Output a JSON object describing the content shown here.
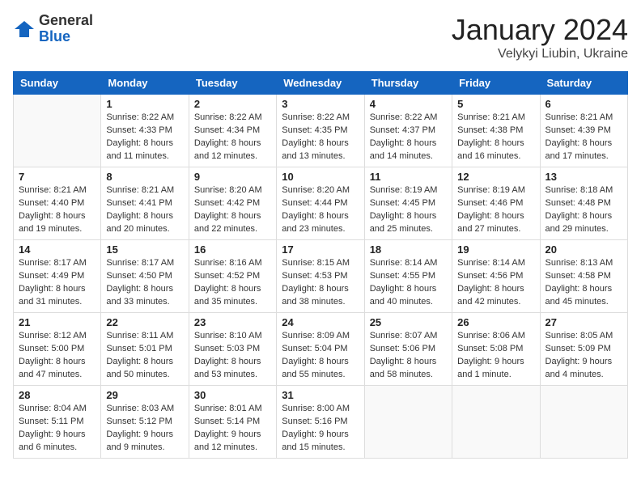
{
  "header": {
    "logo_general": "General",
    "logo_blue": "Blue",
    "month_title": "January 2024",
    "location": "Velykyi Liubin, Ukraine"
  },
  "weekdays": [
    "Sunday",
    "Monday",
    "Tuesday",
    "Wednesday",
    "Thursday",
    "Friday",
    "Saturday"
  ],
  "weeks": [
    [
      {
        "day": "",
        "info": ""
      },
      {
        "day": "1",
        "info": "Sunrise: 8:22 AM\nSunset: 4:33 PM\nDaylight: 8 hours\nand 11 minutes."
      },
      {
        "day": "2",
        "info": "Sunrise: 8:22 AM\nSunset: 4:34 PM\nDaylight: 8 hours\nand 12 minutes."
      },
      {
        "day": "3",
        "info": "Sunrise: 8:22 AM\nSunset: 4:35 PM\nDaylight: 8 hours\nand 13 minutes."
      },
      {
        "day": "4",
        "info": "Sunrise: 8:22 AM\nSunset: 4:37 PM\nDaylight: 8 hours\nand 14 minutes."
      },
      {
        "day": "5",
        "info": "Sunrise: 8:21 AM\nSunset: 4:38 PM\nDaylight: 8 hours\nand 16 minutes."
      },
      {
        "day": "6",
        "info": "Sunrise: 8:21 AM\nSunset: 4:39 PM\nDaylight: 8 hours\nand 17 minutes."
      }
    ],
    [
      {
        "day": "7",
        "info": ""
      },
      {
        "day": "8",
        "info": "Sunrise: 8:21 AM\nSunset: 4:41 PM\nDaylight: 8 hours\nand 20 minutes."
      },
      {
        "day": "9",
        "info": "Sunrise: 8:20 AM\nSunset: 4:42 PM\nDaylight: 8 hours\nand 22 minutes."
      },
      {
        "day": "10",
        "info": "Sunrise: 8:20 AM\nSunset: 4:44 PM\nDaylight: 8 hours\nand 23 minutes."
      },
      {
        "day": "11",
        "info": "Sunrise: 8:19 AM\nSunset: 4:45 PM\nDaylight: 8 hours\nand 25 minutes."
      },
      {
        "day": "12",
        "info": "Sunrise: 8:19 AM\nSunset: 4:46 PM\nDaylight: 8 hours\nand 27 minutes."
      },
      {
        "day": "13",
        "info": "Sunrise: 8:18 AM\nSunset: 4:48 PM\nDaylight: 8 hours\nand 29 minutes."
      }
    ],
    [
      {
        "day": "14",
        "info": ""
      },
      {
        "day": "15",
        "info": "Sunrise: 8:17 AM\nSunset: 4:50 PM\nDaylight: 8 hours\nand 33 minutes."
      },
      {
        "day": "16",
        "info": "Sunrise: 8:16 AM\nSunset: 4:52 PM\nDaylight: 8 hours\nand 35 minutes."
      },
      {
        "day": "17",
        "info": "Sunrise: 8:15 AM\nSunset: 4:53 PM\nDaylight: 8 hours\nand 38 minutes."
      },
      {
        "day": "18",
        "info": "Sunrise: 8:14 AM\nSunset: 4:55 PM\nDaylight: 8 hours\nand 40 minutes."
      },
      {
        "day": "19",
        "info": "Sunrise: 8:14 AM\nSunset: 4:56 PM\nDaylight: 8 hours\nand 42 minutes."
      },
      {
        "day": "20",
        "info": "Sunrise: 8:13 AM\nSunset: 4:58 PM\nDaylight: 8 hours\nand 45 minutes."
      }
    ],
    [
      {
        "day": "21",
        "info": ""
      },
      {
        "day": "22",
        "info": "Sunrise: 8:11 AM\nSunset: 5:01 PM\nDaylight: 8 hours\nand 50 minutes."
      },
      {
        "day": "23",
        "info": "Sunrise: 8:10 AM\nSunset: 5:03 PM\nDaylight: 8 hours\nand 53 minutes."
      },
      {
        "day": "24",
        "info": "Sunrise: 8:09 AM\nSunset: 5:04 PM\nDaylight: 8 hours\nand 55 minutes."
      },
      {
        "day": "25",
        "info": "Sunrise: 8:07 AM\nSunset: 5:06 PM\nDaylight: 8 hours\nand 58 minutes."
      },
      {
        "day": "26",
        "info": "Sunrise: 8:06 AM\nSunset: 5:08 PM\nDaylight: 9 hours\nand 1 minute."
      },
      {
        "day": "27",
        "info": "Sunrise: 8:05 AM\nSunset: 5:09 PM\nDaylight: 9 hours\nand 4 minutes."
      }
    ],
    [
      {
        "day": "28",
        "info": ""
      },
      {
        "day": "29",
        "info": "Sunrise: 8:03 AM\nSunset: 5:12 PM\nDaylight: 9 hours\nand 9 minutes."
      },
      {
        "day": "30",
        "info": "Sunrise: 8:01 AM\nSunset: 5:14 PM\nDaylight: 9 hours\nand 12 minutes."
      },
      {
        "day": "31",
        "info": "Sunrise: 8:00 AM\nSunset: 5:16 PM\nDaylight: 9 hours\nand 15 minutes."
      },
      {
        "day": "",
        "info": ""
      },
      {
        "day": "",
        "info": ""
      },
      {
        "day": "",
        "info": ""
      }
    ]
  ],
  "week1_sun": "Sunrise: 8:21 AM\nSunset: 4:40 PM\nDaylight: 8 hours\nand 19 minutes.",
  "week3_sun": "Sunrise: 8:17 AM\nSunset: 4:49 PM\nDaylight: 8 hours\nand 31 minutes.",
  "week4_sun": "Sunrise: 8:12 AM\nSunset: 5:00 PM\nDaylight: 8 hours\nand 47 minutes.",
  "week5_sun": "Sunrise: 8:04 AM\nSunset: 5:11 PM\nDaylight: 9 hours\nand 6 minutes."
}
